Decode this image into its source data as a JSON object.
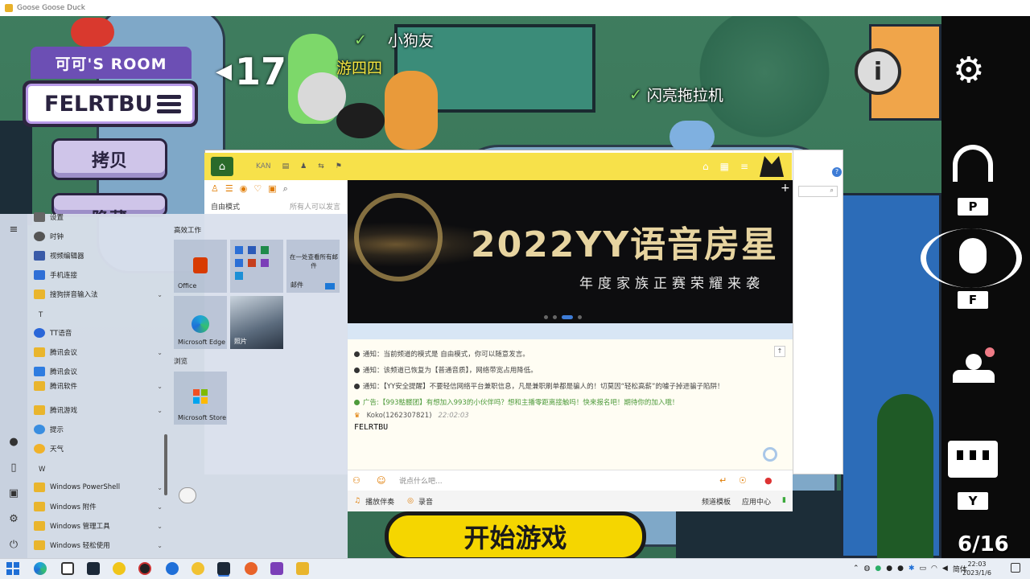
{
  "window": {
    "title": "Goose Goose Duck"
  },
  "game": {
    "room_label": "可可'S ROOM",
    "room_code": "FELRTBU",
    "copy_button": "拷贝",
    "hide_button": "隐藏",
    "players": [
      {
        "name": "小狗友"
      },
      {
        "name": "游四四"
      },
      {
        "name": "闪亮拖拉机"
      }
    ],
    "count_badge": "17",
    "start_button": "开始游戏",
    "player_count": "6/16",
    "hud": {
      "voice_key": "P",
      "mic_key": "F",
      "chat_key": "Y"
    }
  },
  "yy": {
    "channel_name": "KAN",
    "left_filter": "自由模式",
    "left_note": "所有人可以发言",
    "banner": {
      "title": "2022YY语音房星",
      "subtitle": "年度家族正赛荣耀来袭"
    },
    "notices": [
      {
        "text": "通知：当前频道的模式是 自由模式，你可以随意发言。",
        "type": "normal"
      },
      {
        "text": "通知：该频道已恢复为【普通音质】，网络带宽占用降低。",
        "type": "normal"
      },
      {
        "text": "通知：【YY安全提醒】不要轻信网络平台兼职信息，凡是兼职刷单都是骗人的！切莫因“轻松高薪”的噱子掉进骗子陷阱！",
        "type": "normal"
      },
      {
        "text": "广告:【993骷髅团】有想加入993的小伙伴吗？想和主播零距离接触吗！快来报名吧！期待你的加入哦！",
        "type": "ad"
      }
    ],
    "chat": {
      "user": "Koko(1262307821)",
      "time": "22:02:03",
      "message": "FELRTBU"
    },
    "input_placeholder": "说点什么吧...",
    "bottom": {
      "accompany": "播放伴奏",
      "record": "录音",
      "template": "频道模板",
      "apps": "应用中心"
    }
  },
  "start_menu": {
    "apps": [
      {
        "label": "设置"
      },
      {
        "label": "时钟"
      },
      {
        "label": "视频编辑器"
      },
      {
        "label": "手机连接"
      },
      {
        "label": "搜狗拼音输入法"
      },
      {
        "label": "TT语音"
      },
      {
        "label": "腾讯会议"
      },
      {
        "label": "腾讯会议"
      },
      {
        "label": "腾讯软件"
      },
      {
        "label": "腾讯游戏"
      },
      {
        "label": "提示"
      },
      {
        "label": "天气"
      },
      {
        "label": "Windows PowerShell"
      },
      {
        "label": "Windows 附件"
      },
      {
        "label": "Windows 管理工具"
      },
      {
        "label": "Windows 轻松使用"
      }
    ],
    "letters": [
      "T",
      "W"
    ],
    "group_productivity": "高效工作",
    "group_browse": "浏览",
    "tiles": {
      "office": "Office",
      "mail_promo": "在一处查看所有邮件",
      "mail": "邮件",
      "edge": "Microsoft Edge",
      "photos": "照片",
      "store": "Microsoft Store"
    }
  },
  "taskbar": {
    "ime": "简体",
    "time": "22:03",
    "date": "2023/1/6"
  }
}
